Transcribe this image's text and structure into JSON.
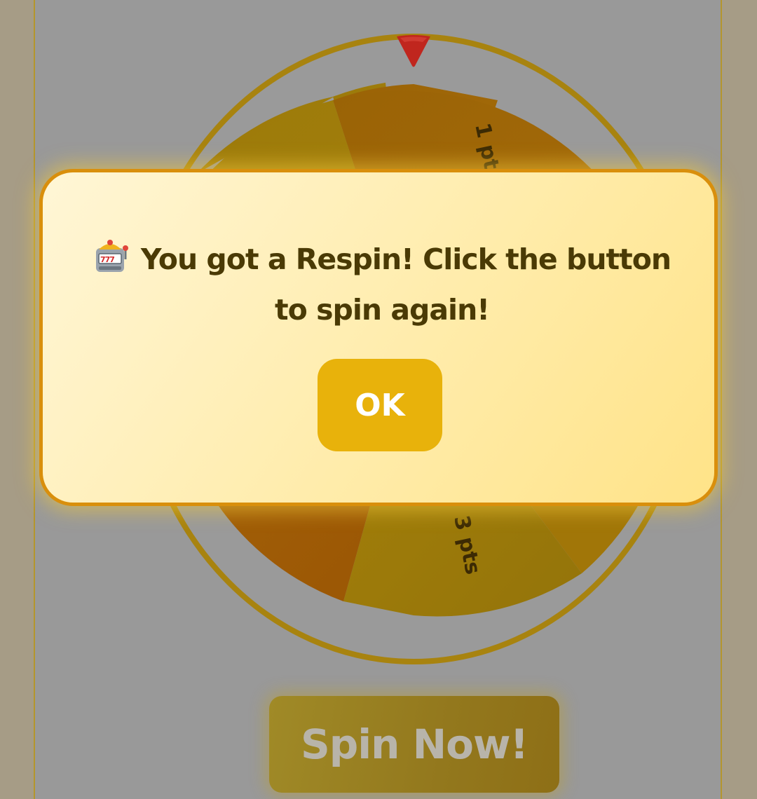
{
  "wheel": {
    "segments": [
      {
        "label": "1 pt",
        "color": "#a8670a"
      },
      {
        "label": "3 pts",
        "color": "#a87a08"
      }
    ],
    "pointer_color": "#c0261e",
    "ring_color": "#a8830f"
  },
  "spin_button": {
    "label": "Spin Now!"
  },
  "modal": {
    "icon": "slot-machine-icon",
    "message": "You got a Respin! Click the button to spin again!",
    "ok_label": "OK",
    "accent_color": "#e8b20b",
    "border_color": "#d98f0c"
  }
}
